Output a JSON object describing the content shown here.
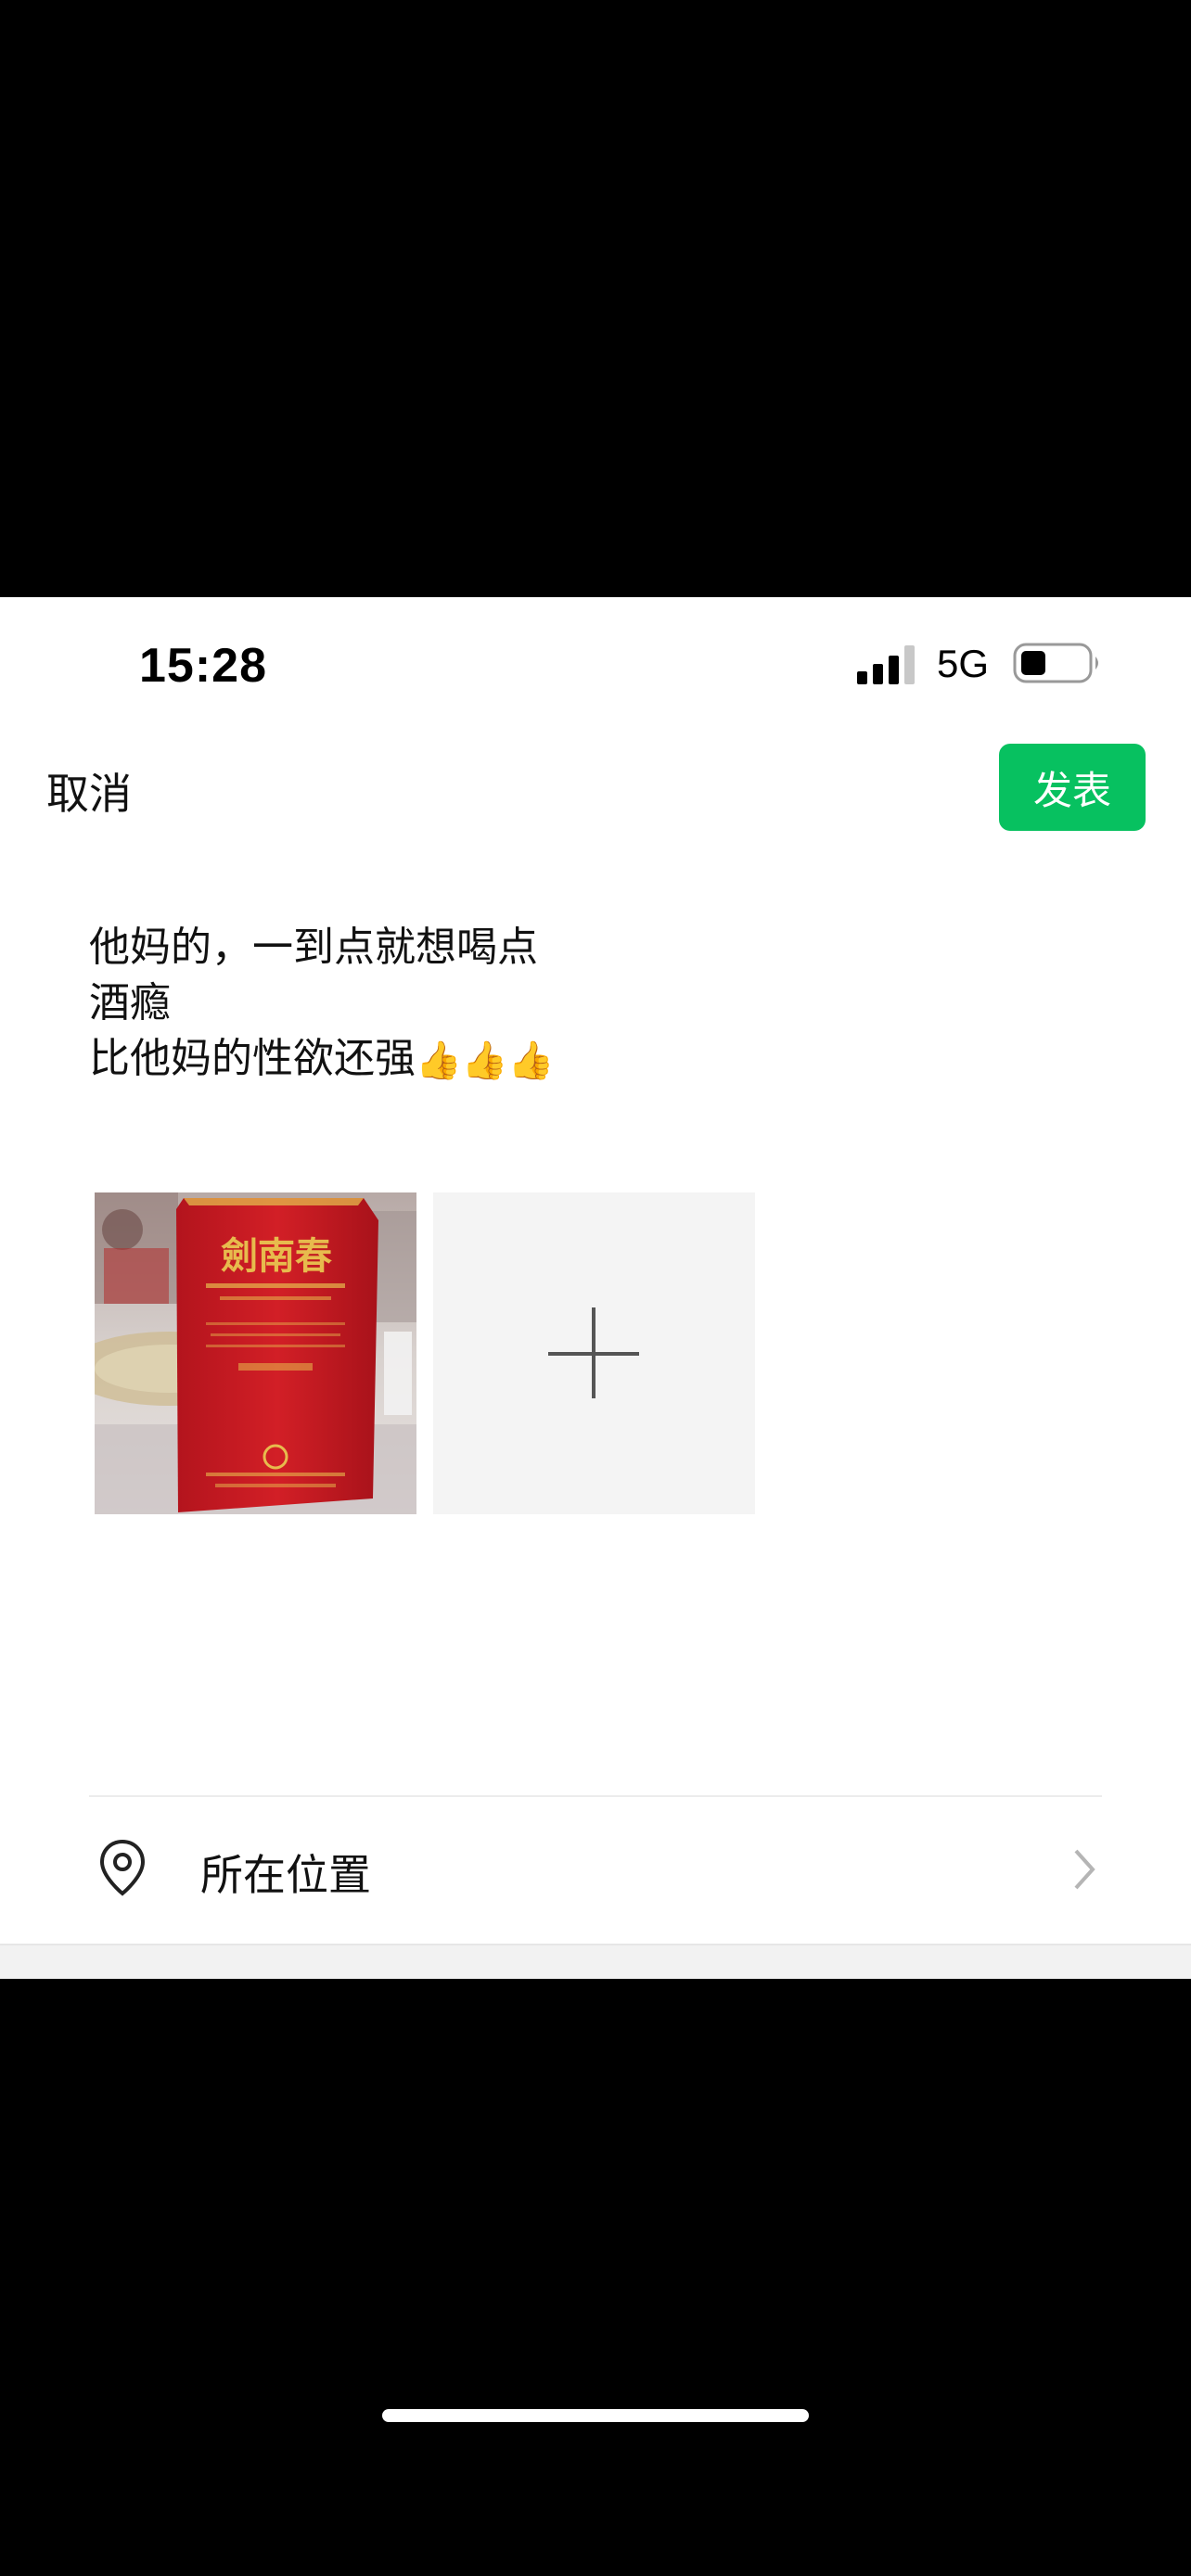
{
  "status_bar": {
    "time": "15:28",
    "network": "5G",
    "battery_level": 0.3
  },
  "nav": {
    "cancel_label": "取消",
    "publish_label": "发表"
  },
  "post": {
    "lines": [
      "他妈的，一到点就想喝点",
      "酒瘾",
      "比他妈的性欲还强"
    ],
    "emoji": "👍👍👍"
  },
  "photo": {
    "brand_text": "劍南春"
  },
  "location": {
    "label": "所在位置"
  },
  "colors": {
    "accent": "#07c160"
  },
  "icons": {
    "location": "location-pin-icon",
    "chevron": "chevron-right-icon",
    "add": "plus-icon"
  }
}
